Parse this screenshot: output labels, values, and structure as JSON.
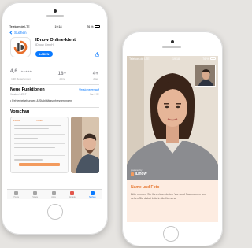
{
  "left_phone": {
    "status": {
      "carrier": "Telekom.de LTE",
      "time": "19:18",
      "battery": "76 %"
    },
    "nav": {
      "back_label": "Suchen"
    },
    "app": {
      "name": "IDnow Online-Ident",
      "developer": "IDnow GmbH",
      "get_label": "LADEN"
    },
    "stats": {
      "rating": "4,6",
      "rating_count": "1,3K Bewertungen",
      "age": "18+",
      "age_label": "Jahre",
      "rank": "4+",
      "rank_label": "Alter"
    },
    "whats_new": {
      "title": "Neue Funktionen",
      "link": "Versionsverlauf",
      "version": "Version 3.23.7",
      "date": "Vor 2 W.",
      "note": "• Fehlerbehebungen & Stabilitätsverbesserungen."
    },
    "preview": {
      "title": "Vorschau",
      "shot_back": "Zurück",
      "shot_title": "Daten"
    },
    "tabs": [
      {
        "label": "Heute"
      },
      {
        "label": "Spiele"
      },
      {
        "label": "Apps"
      },
      {
        "label": "Arcade"
      },
      {
        "label": "Suchen"
      }
    ]
  },
  "right_phone": {
    "status": {
      "carrier": "Telekom.de LTE",
      "time": "19:18",
      "battery": "76 %"
    },
    "brand": {
      "sub": "powered by",
      "name": "IDnow"
    },
    "panel": {
      "title": "Name und Foto",
      "text": "Bitte nennen Sie Ihren kompletten Vor- und Nachnamen und sehen Sie dabei bitte in die Kamera."
    }
  },
  "colors": {
    "accent_blue": "#0a7aff",
    "accent_orange": "#e77b37",
    "background": "#e6e4e1"
  }
}
